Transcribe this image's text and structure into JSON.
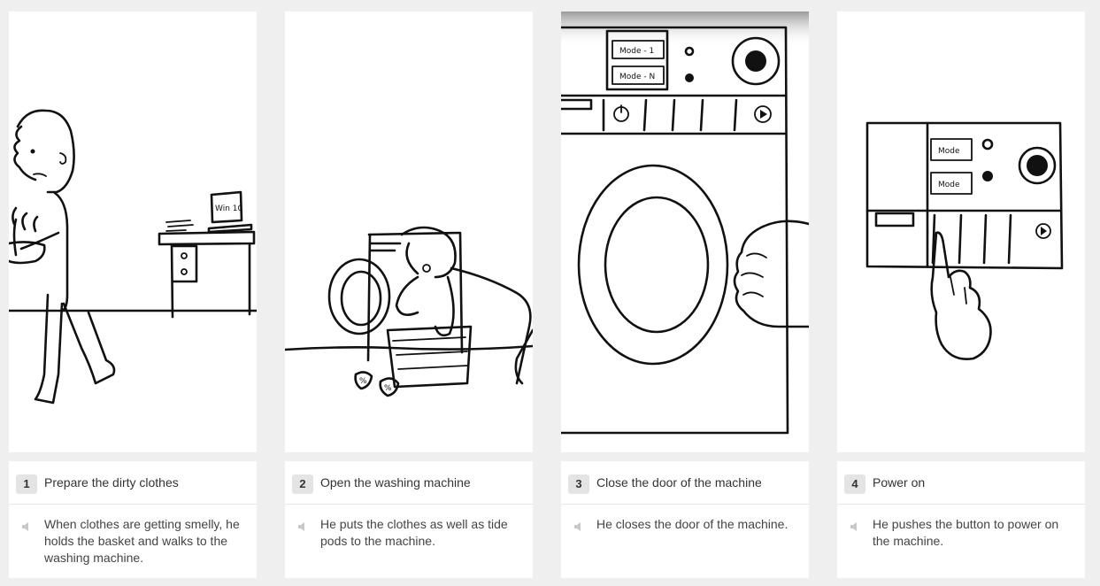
{
  "steps": [
    {
      "number": "1",
      "title": "Prepare the dirty clothes",
      "description": "When clothes are getting smelly, he holds the basket and walks to the washing machine.",
      "scene_labels": {
        "laptop_screen": "Win 10"
      }
    },
    {
      "number": "2",
      "title": "Open the washing machine",
      "description": "He puts the clothes as well as tide pods to the machine.",
      "scene_labels": {
        "pod_symbol": "%"
      }
    },
    {
      "number": "3",
      "title": "Close the door of the machine",
      "description": "He closes the door of the machine.",
      "scene_labels": {
        "mode_1": "Mode - 1",
        "mode_n": "Mode - N"
      }
    },
    {
      "number": "4",
      "title": "Power on",
      "description": "He pushes the button to power on the machine.",
      "scene_labels": {
        "mode_a": "Mode",
        "mode_b": "Mode"
      }
    }
  ],
  "icons": {
    "narration": "speaker-icon"
  },
  "colors": {
    "background": "#efefef",
    "panel": "#ffffff",
    "badge": "#e4e4e4",
    "divider": "#e6e6e6"
  }
}
